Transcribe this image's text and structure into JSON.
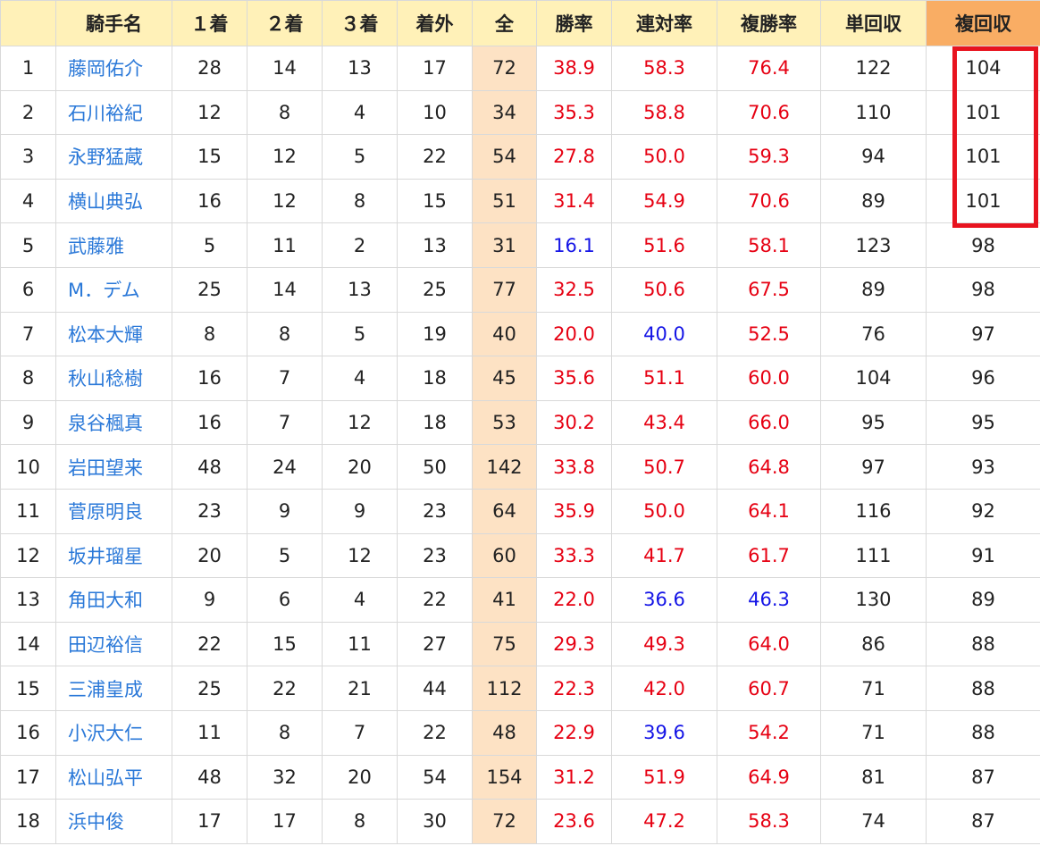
{
  "headers": {
    "rank": "",
    "name": "騎手名",
    "first": "１着",
    "second": "２着",
    "third": "３着",
    "out": "着外",
    "total": "全",
    "win_rate": "勝率",
    "quinella_rate": "連対率",
    "show_rate": "複勝率",
    "win_return": "単回収",
    "show_return": "複回収"
  },
  "colors": {
    "above_average": "#e60012",
    "below_average": "#1414e6",
    "link": "#2a78d8",
    "header_bg": "#fff1b8",
    "sorted_header_bg": "#f9ad64",
    "total_col_bg": "#fde2c4",
    "highlight_border": "#e8131f"
  },
  "rows": [
    {
      "rank": "1",
      "name": "藤岡佑介",
      "first": "28",
      "second": "14",
      "third": "13",
      "out": "17",
      "total": "72",
      "win_rate": "38.9",
      "quinella_rate": "58.3",
      "show_rate": "76.4",
      "win_return": "122",
      "show_return": "104",
      "win_rate_color": "hi",
      "quinella_rate_color": "hi",
      "show_rate_color": "hi"
    },
    {
      "rank": "2",
      "name": "石川裕紀",
      "first": "12",
      "second": "8",
      "third": "4",
      "out": "10",
      "total": "34",
      "win_rate": "35.3",
      "quinella_rate": "58.8",
      "show_rate": "70.6",
      "win_return": "110",
      "show_return": "101",
      "win_rate_color": "hi",
      "quinella_rate_color": "hi",
      "show_rate_color": "hi"
    },
    {
      "rank": "3",
      "name": "永野猛蔵",
      "first": "15",
      "second": "12",
      "third": "5",
      "out": "22",
      "total": "54",
      "win_rate": "27.8",
      "quinella_rate": "50.0",
      "show_rate": "59.3",
      "win_return": "94",
      "show_return": "101",
      "win_rate_color": "hi",
      "quinella_rate_color": "hi",
      "show_rate_color": "hi"
    },
    {
      "rank": "4",
      "name": "横山典弘",
      "first": "16",
      "second": "12",
      "third": "8",
      "out": "15",
      "total": "51",
      "win_rate": "31.4",
      "quinella_rate": "54.9",
      "show_rate": "70.6",
      "win_return": "89",
      "show_return": "101",
      "win_rate_color": "hi",
      "quinella_rate_color": "hi",
      "show_rate_color": "hi"
    },
    {
      "rank": "5",
      "name": "武藤雅",
      "first": "5",
      "second": "11",
      "third": "2",
      "out": "13",
      "total": "31",
      "win_rate": "16.1",
      "quinella_rate": "51.6",
      "show_rate": "58.1",
      "win_return": "123",
      "show_return": "98",
      "win_rate_color": "lo",
      "quinella_rate_color": "hi",
      "show_rate_color": "hi"
    },
    {
      "rank": "6",
      "name": "M．デム",
      "first": "25",
      "second": "14",
      "third": "13",
      "out": "25",
      "total": "77",
      "win_rate": "32.5",
      "quinella_rate": "50.6",
      "show_rate": "67.5",
      "win_return": "89",
      "show_return": "98",
      "win_rate_color": "hi",
      "quinella_rate_color": "hi",
      "show_rate_color": "hi"
    },
    {
      "rank": "7",
      "name": "松本大輝",
      "first": "8",
      "second": "8",
      "third": "5",
      "out": "19",
      "total": "40",
      "win_rate": "20.0",
      "quinella_rate": "40.0",
      "show_rate": "52.5",
      "win_return": "76",
      "show_return": "97",
      "win_rate_color": "hi",
      "quinella_rate_color": "lo",
      "show_rate_color": "hi"
    },
    {
      "rank": "8",
      "name": "秋山稔樹",
      "first": "16",
      "second": "7",
      "third": "4",
      "out": "18",
      "total": "45",
      "win_rate": "35.6",
      "quinella_rate": "51.1",
      "show_rate": "60.0",
      "win_return": "104",
      "show_return": "96",
      "win_rate_color": "hi",
      "quinella_rate_color": "hi",
      "show_rate_color": "hi"
    },
    {
      "rank": "9",
      "name": "泉谷楓真",
      "first": "16",
      "second": "7",
      "third": "12",
      "out": "18",
      "total": "53",
      "win_rate": "30.2",
      "quinella_rate": "43.4",
      "show_rate": "66.0",
      "win_return": "95",
      "show_return": "95",
      "win_rate_color": "hi",
      "quinella_rate_color": "hi",
      "show_rate_color": "hi"
    },
    {
      "rank": "10",
      "name": "岩田望来",
      "first": "48",
      "second": "24",
      "third": "20",
      "out": "50",
      "total": "142",
      "win_rate": "33.8",
      "quinella_rate": "50.7",
      "show_rate": "64.8",
      "win_return": "97",
      "show_return": "93",
      "win_rate_color": "hi",
      "quinella_rate_color": "hi",
      "show_rate_color": "hi"
    },
    {
      "rank": "11",
      "name": "菅原明良",
      "first": "23",
      "second": "9",
      "third": "9",
      "out": "23",
      "total": "64",
      "win_rate": "35.9",
      "quinella_rate": "50.0",
      "show_rate": "64.1",
      "win_return": "116",
      "show_return": "92",
      "win_rate_color": "hi",
      "quinella_rate_color": "hi",
      "show_rate_color": "hi"
    },
    {
      "rank": "12",
      "name": "坂井瑠星",
      "first": "20",
      "second": "5",
      "third": "12",
      "out": "23",
      "total": "60",
      "win_rate": "33.3",
      "quinella_rate": "41.7",
      "show_rate": "61.7",
      "win_return": "111",
      "show_return": "91",
      "win_rate_color": "hi",
      "quinella_rate_color": "hi",
      "show_rate_color": "hi"
    },
    {
      "rank": "13",
      "name": "角田大和",
      "first": "9",
      "second": "6",
      "third": "4",
      "out": "22",
      "total": "41",
      "win_rate": "22.0",
      "quinella_rate": "36.6",
      "show_rate": "46.3",
      "win_return": "130",
      "show_return": "89",
      "win_rate_color": "hi",
      "quinella_rate_color": "lo",
      "show_rate_color": "lo"
    },
    {
      "rank": "14",
      "name": "田辺裕信",
      "first": "22",
      "second": "15",
      "third": "11",
      "out": "27",
      "total": "75",
      "win_rate": "29.3",
      "quinella_rate": "49.3",
      "show_rate": "64.0",
      "win_return": "86",
      "show_return": "88",
      "win_rate_color": "hi",
      "quinella_rate_color": "hi",
      "show_rate_color": "hi"
    },
    {
      "rank": "15",
      "name": "三浦皇成",
      "first": "25",
      "second": "22",
      "third": "21",
      "out": "44",
      "total": "112",
      "win_rate": "22.3",
      "quinella_rate": "42.0",
      "show_rate": "60.7",
      "win_return": "71",
      "show_return": "88",
      "win_rate_color": "hi",
      "quinella_rate_color": "hi",
      "show_rate_color": "hi"
    },
    {
      "rank": "16",
      "name": "小沢大仁",
      "first": "11",
      "second": "8",
      "third": "7",
      "out": "22",
      "total": "48",
      "win_rate": "22.9",
      "quinella_rate": "39.6",
      "show_rate": "54.2",
      "win_return": "71",
      "show_return": "88",
      "win_rate_color": "hi",
      "quinella_rate_color": "lo",
      "show_rate_color": "hi"
    },
    {
      "rank": "17",
      "name": "松山弘平",
      "first": "48",
      "second": "32",
      "third": "20",
      "out": "54",
      "total": "154",
      "win_rate": "31.2",
      "quinella_rate": "51.9",
      "show_rate": "64.9",
      "win_return": "81",
      "show_return": "87",
      "win_rate_color": "hi",
      "quinella_rate_color": "hi",
      "show_rate_color": "hi"
    },
    {
      "rank": "18",
      "name": "浜中俊",
      "first": "17",
      "second": "17",
      "third": "8",
      "out": "30",
      "total": "72",
      "win_rate": "23.6",
      "quinella_rate": "47.2",
      "show_rate": "58.3",
      "win_return": "74",
      "show_return": "87",
      "win_rate_color": "hi",
      "quinella_rate_color": "hi",
      "show_rate_color": "hi"
    }
  ]
}
